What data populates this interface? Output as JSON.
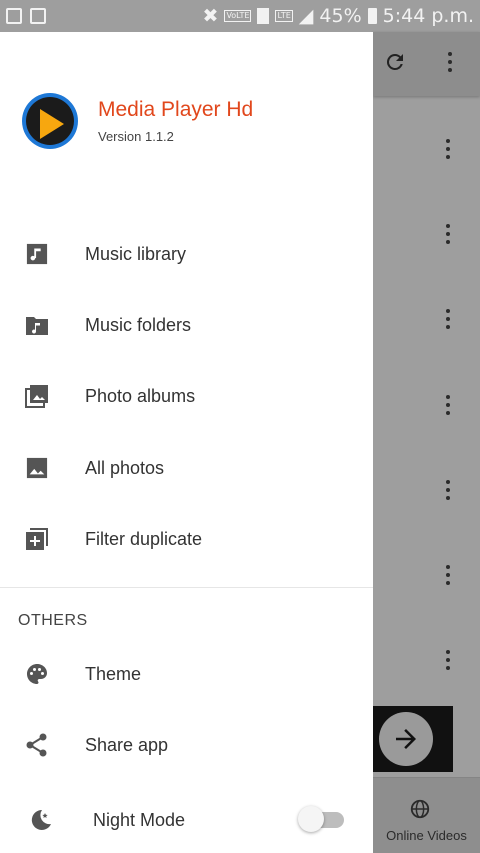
{
  "status_bar": {
    "left_icons": [
      "image-download-icon",
      "gallery-icon"
    ],
    "volte_label": "VoLTE",
    "lte_label": "LTE",
    "battery_percent": "45%",
    "time": "5:44 p.m."
  },
  "drawer": {
    "app_name": "Media Player Hd",
    "version": "Version 1.1.2",
    "items": [
      {
        "label": "Music library",
        "icon": "music-note-icon"
      },
      {
        "label": "Music folders",
        "icon": "music-folder-icon"
      },
      {
        "label": "Photo albums",
        "icon": "photo-albums-icon"
      },
      {
        "label": "All photos",
        "icon": "photo-icon"
      },
      {
        "label": "Filter duplicate",
        "icon": "filter-duplicate-icon"
      }
    ],
    "others_title": "OTHERS",
    "others_items": [
      {
        "label": "Theme",
        "icon": "palette-icon"
      },
      {
        "label": "Share app",
        "icon": "share-icon"
      },
      {
        "label": "Night Mode",
        "icon": "night-mode-icon",
        "toggle_on": false
      }
    ]
  },
  "background_app": {
    "bottom_nav_label": "Online Videos"
  },
  "colors": {
    "brand": "#e1471c",
    "scrim": "#9e9e9e",
    "logo_ring": "#1e78d6",
    "logo_play": "#f7a70f"
  }
}
